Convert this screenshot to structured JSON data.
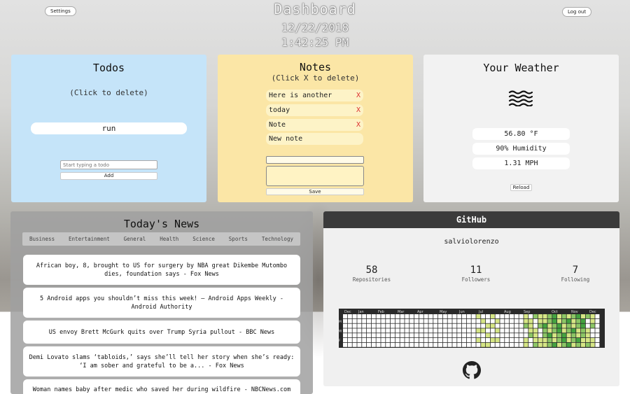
{
  "header": {
    "title": "Dashboard",
    "date": "12/22/2018",
    "time": "1:42:25 PM",
    "settings_label": "Settings",
    "logout_label": "Log out"
  },
  "todos": {
    "title": "Todos",
    "hint": "(Click to delete)",
    "items": [
      "run"
    ],
    "input_placeholder": "Start typing a todo",
    "add_label": "Add"
  },
  "notes": {
    "title": "Notes",
    "hint": "(Click X to delete)",
    "items": [
      {
        "text": "Here is another",
        "x": "X"
      },
      {
        "text": "today",
        "x": "X"
      },
      {
        "text": "Note",
        "x": "X"
      },
      {
        "text": "New note"
      }
    ],
    "save_label": "Save"
  },
  "weather": {
    "title": "Your Weather",
    "icon": "fog-icon",
    "temperature": "56.80 °F",
    "humidity": "90% Humidity",
    "wind": "1.31 MPH",
    "reload_label": "Reload"
  },
  "news": {
    "title": "Today's News",
    "categories": [
      "Business",
      "Entertainment",
      "General",
      "Health",
      "Science",
      "Sports",
      "Technology"
    ],
    "items": [
      "African boy, 8, brought to US for surgery by NBA great Dikembe Mutombo dies, foundation says - Fox News",
      "5 Android apps you shouldn’t miss this week! — Android Apps Weekly - Android Authority",
      "US envoy Brett McGurk quits over Trump Syria pullout - BBC News",
      "Demi Lovato slams ‘tabloids,’ says she’ll tell her story when she’s ready: ‘I am sober and grateful to be a... - Fox News",
      "Woman names baby after medic who saved her during wildfire - NBCNews.com"
    ]
  },
  "github": {
    "title": "GitHub",
    "username": "salviolorenzo",
    "repositories": "58",
    "repositories_label": "Repositories",
    "followers": "11",
    "followers_label": "Followers",
    "following": "7",
    "following_label": "Following",
    "months": [
      "Dec",
      "Jan",
      "Feb",
      "Mar",
      "Apr",
      "May",
      "Jun",
      "Jul",
      "Aug",
      "Sep",
      "Oct",
      "Nov",
      "Dec"
    ],
    "days": [
      "",
      "M",
      "",
      "W",
      "",
      "F",
      ""
    ],
    "colors": [
      "#ffffff",
      "#d6e685",
      "#8cc665",
      "#44a340"
    ],
    "activity_weeks": [
      [],
      [],
      [],
      [],
      [],
      [],
      [],
      [],
      [],
      [],
      [],
      [],
      [],
      [],
      [],
      [],
      [],
      [],
      [],
      [],
      [],
      [],
      [],
      [],
      [],
      [],
      [],
      [],
      [],
      [],
      [],
      [],
      [],
      [],
      [],
      [],
      [],
      [],
      [],
      [],
      [],
      [],
      [],
      [],
      [],
      [],
      [],
      [],
      [],
      [],
      [],
      [],
      [],
      []
    ]
  }
}
